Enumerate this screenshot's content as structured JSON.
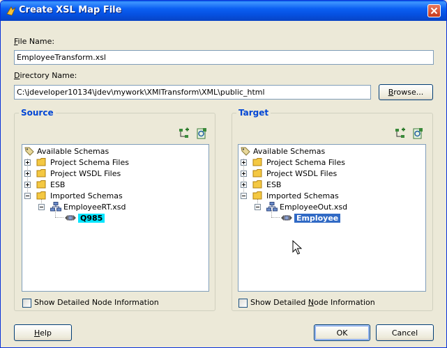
{
  "window": {
    "title": "Create XSL Map File"
  },
  "file_name": {
    "label_mnemonic": "F",
    "label_rest": "ile Name:",
    "value": "EmployeeTransform.xsl"
  },
  "directory_name": {
    "label_mnemonic": "D",
    "label_rest": "irectory Name:",
    "value": "C:\\jdeveloper10134\\jdev\\mywork\\XMlTransform\\XML\\public_html"
  },
  "browse_button": {
    "pre": "",
    "mnemonic": "B",
    "post": "rowse..."
  },
  "source": {
    "title": "Source",
    "tree": {
      "root": "Available Schemas",
      "items": [
        "Project Schema Files",
        "Project WSDL Files",
        "ESB",
        "Imported Schemas"
      ],
      "schema_file": "EmployeeRT.xsd",
      "element": "Q985"
    },
    "checkbox": {
      "label": "Show Detailed Node Information",
      "checked": false
    }
  },
  "target": {
    "title": "Target",
    "tree": {
      "root": "Available Schemas",
      "items": [
        "Project Schema Files",
        "Project WSDL Files",
        "ESB",
        "Imported Schemas"
      ],
      "schema_file": "EmployeeOut.xsd",
      "element": "Employee"
    },
    "checkbox": {
      "pre": "Show Detailed ",
      "mnemonic": "N",
      "post": "ode Information",
      "checked": false
    }
  },
  "help_button": {
    "mnemonic": "H",
    "post": "elp"
  },
  "ok_button": {
    "label": "OK"
  },
  "cancel_button": {
    "label": "Cancel"
  },
  "icons": [
    "jdeveloper-icon",
    "close-icon",
    "import-schema-icon",
    "new-schema-icon",
    "folder-icon",
    "schema-file-icon",
    "element-icon",
    "mouse-cursor"
  ]
}
